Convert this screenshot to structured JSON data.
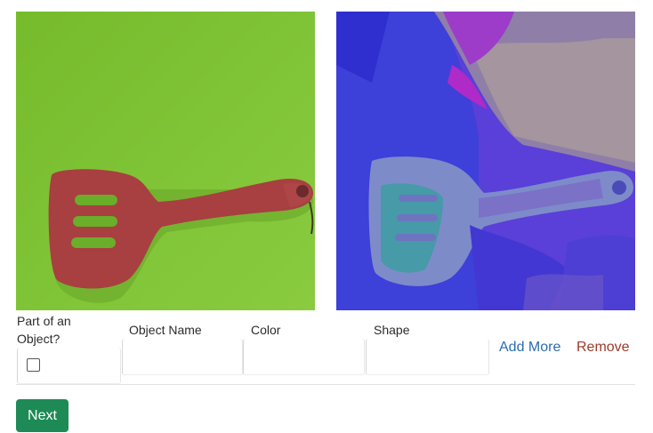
{
  "images": {
    "left": {
      "icon": "spatula-photo-green-background",
      "bg_color": "#7cc132",
      "object_color": "#a83f41"
    },
    "right": {
      "icon": "spatula-photo-false-color",
      "bg_color": "#5b3bd6"
    }
  },
  "form": {
    "part_of_object_label": "Part of an Object?",
    "object_name_label": "Object Name",
    "color_label": "Color",
    "shape_label": "Shape",
    "object_name_value": "",
    "color_value": "",
    "shape_value": "",
    "part_of_object_checked": false,
    "add_more_label": "Add More",
    "remove_label": "Remove"
  },
  "actions": {
    "next_label": "Next"
  }
}
